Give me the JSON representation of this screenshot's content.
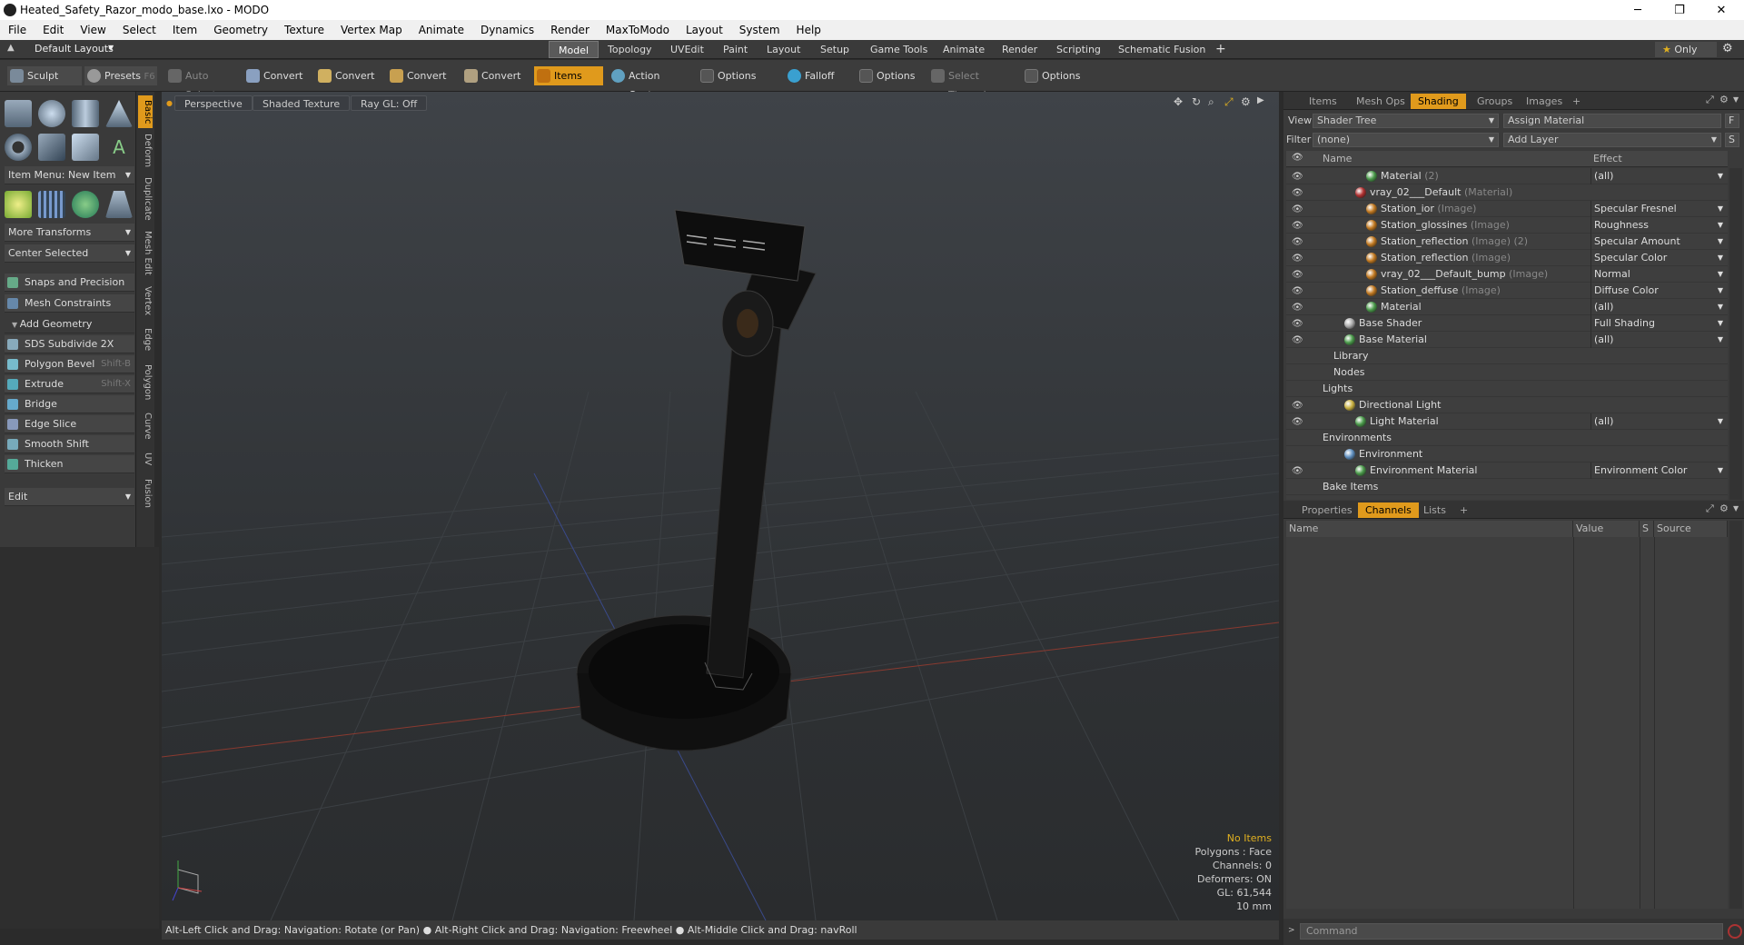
{
  "window": {
    "title": "Heated_Safety_Razor_modo_base.lxo - MODO",
    "min": "─",
    "max": "❐",
    "close": "✕"
  },
  "menu": [
    "File",
    "Edit",
    "View",
    "Select",
    "Item",
    "Geometry",
    "Texture",
    "Vertex Map",
    "Animate",
    "Dynamics",
    "Render",
    "MaxToModo",
    "Layout",
    "System",
    "Help"
  ],
  "layout": {
    "selector": "Default Layouts",
    "tabs": [
      "Model",
      "Topology",
      "UVEdit",
      "Paint",
      "Layout",
      "Setup",
      "Game Tools",
      "Animate",
      "Render",
      "Scripting",
      "Schematic Fusion"
    ],
    "add": "+",
    "only": "Only"
  },
  "toolbar": {
    "sculpt": "Sculpt",
    "presets": "Presets",
    "presets_key": "F6",
    "auto_select": "Auto Select",
    "convert1": "Convert",
    "convert2": "Convert",
    "convert3": "Convert",
    "convert4": "Convert",
    "items": "Items",
    "action_center": "Action Center",
    "options1": "Options",
    "falloff": "Falloff",
    "options2": "Options",
    "select_through": "Select Through",
    "options3": "Options"
  },
  "left": {
    "item_menu": "Item Menu: New Item",
    "more_transforms": "More Transforms",
    "center_selected": "Center Selected",
    "snaps": "Snaps and Precision",
    "mesh_constraints": "Mesh Constraints",
    "add_geometry": "Add Geometry",
    "tools": [
      {
        "label": "SDS Subdivide 2X",
        "key": ""
      },
      {
        "label": "Polygon Bevel",
        "key": "Shift-B"
      },
      {
        "label": "Extrude",
        "key": "Shift-X"
      },
      {
        "label": "Bridge",
        "key": ""
      },
      {
        "label": "Edge Slice",
        "key": ""
      },
      {
        "label": "Smooth Shift",
        "key": ""
      },
      {
        "label": "Thicken",
        "key": ""
      }
    ],
    "edit": "Edit",
    "vtabs": [
      "Basic",
      "Deform",
      "Duplicate",
      "Mesh Edit",
      "Vertex",
      "Edge",
      "Polygon",
      "Curve",
      "UV",
      "Fusion"
    ]
  },
  "viewport": {
    "perspective": "Perspective",
    "shading": "Shaded Texture",
    "raygl": "Ray GL: Off",
    "info": {
      "items": "No Items",
      "polygons": "Polygons : Face",
      "channels": "Channels: 0",
      "deformers": "Deformers: ON",
      "gl": "GL: 61,544",
      "scale": "10 mm"
    }
  },
  "status": "Alt-Left Click and Drag: Navigation: Rotate (or Pan) ● Alt-Right Click and Drag: Navigation: Freewheel ● Alt-Middle Click and Drag: navRoll",
  "right": {
    "tabs": [
      "Items",
      "Mesh Ops",
      "Shading",
      "Groups",
      "Images",
      "+"
    ],
    "view_label": "View",
    "view_value": "Shader Tree",
    "assign": "Assign Material",
    "filter_label": "Filter",
    "filter_value": "(none)",
    "add_layer": "Add Layer",
    "col_name": "Name",
    "col_effect": "Effect",
    "tree": [
      {
        "name": "Material",
        "suffix": "(2)",
        "effect": "(all)",
        "indent": 88,
        "dot": "#4a9a4a",
        "eye": true
      },
      {
        "name": "vray_02___Default",
        "suffix": "(Material)",
        "effect": "",
        "indent": 76,
        "dot": "#b03030",
        "eye": true
      },
      {
        "name": "Station_ior",
        "suffix": "(Image)",
        "effect": "Specular Fresnel",
        "indent": 88,
        "dot": "#c07820",
        "eye": true
      },
      {
        "name": "Station_glossines",
        "suffix": "(Image)",
        "effect": "Roughness",
        "indent": 88,
        "dot": "#c07820",
        "eye": true
      },
      {
        "name": "Station_reflection",
        "suffix": "(Image) (2)",
        "effect": "Specular Amount",
        "indent": 88,
        "dot": "#c07820",
        "eye": true
      },
      {
        "name": "Station_reflection",
        "suffix": "(Image)",
        "effect": "Specular Color",
        "indent": 88,
        "dot": "#c07820",
        "eye": true
      },
      {
        "name": "vray_02___Default_bump",
        "suffix": "(Image)",
        "effect": "Normal",
        "indent": 88,
        "dot": "#c07820",
        "eye": true
      },
      {
        "name": "Station_deffuse",
        "suffix": "(Image)",
        "effect": "Diffuse Color",
        "indent": 88,
        "dot": "#c07820",
        "eye": true
      },
      {
        "name": "Material",
        "suffix": "",
        "effect": "(all)",
        "indent": 88,
        "dot": "#4a9a4a",
        "eye": true
      },
      {
        "name": "Base Shader",
        "suffix": "",
        "effect": "Full Shading",
        "indent": 64,
        "dot": "#aaaaaa",
        "eye": true
      },
      {
        "name": "Base Material",
        "suffix": "",
        "effect": "(all)",
        "indent": 64,
        "dot": "#4a9a4a",
        "eye": true
      },
      {
        "name": "Library",
        "suffix": "",
        "effect": "",
        "indent": 52,
        "dot": "",
        "eye": false
      },
      {
        "name": "Nodes",
        "suffix": "",
        "effect": "",
        "indent": 52,
        "dot": "",
        "eye": false
      },
      {
        "name": "Lights",
        "suffix": "",
        "effect": "",
        "indent": 40,
        "dot": "",
        "eye": false
      },
      {
        "name": "Directional Light",
        "suffix": "",
        "effect": "",
        "indent": 64,
        "dot": "#c8b040",
        "eye": true
      },
      {
        "name": "Light Material",
        "suffix": "",
        "effect": "(all)",
        "indent": 76,
        "dot": "#4a9a4a",
        "eye": true
      },
      {
        "name": "Environments",
        "suffix": "",
        "effect": "",
        "indent": 40,
        "dot": "",
        "eye": false
      },
      {
        "name": "Environment",
        "suffix": "",
        "effect": "",
        "indent": 64,
        "dot": "#6090c0",
        "eye": false
      },
      {
        "name": "Environment Material",
        "suffix": "",
        "effect": "Environment Color",
        "indent": 76,
        "dot": "#4a9a4a",
        "eye": true
      },
      {
        "name": "Bake Items",
        "suffix": "",
        "effect": "",
        "indent": 40,
        "dot": "",
        "eye": false
      }
    ],
    "lower_tabs": [
      "Properties",
      "Channels",
      "Lists",
      "+"
    ],
    "ch_cols": [
      "Name",
      "Value",
      "S",
      "Source"
    ],
    "command": "Command"
  }
}
